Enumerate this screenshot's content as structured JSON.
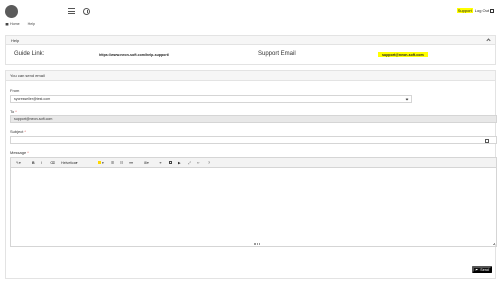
{
  "header": {
    "support_label": "Support",
    "logout_label": "Log Out"
  },
  "breadcrumb": {
    "home": "Home",
    "current": "Help"
  },
  "help_panel": {
    "title": "Help",
    "guide_label": "Guide Link:",
    "guide_url": "https://www.neon-soft.com/help-support/",
    "support_email_label": "Support Email",
    "support_email": "support@neon-soft.com"
  },
  "send_panel": {
    "title": "You can send email",
    "from_label": "From",
    "from_value": "sycresseller@test.com",
    "to_label": "To",
    "to_value": "support@neon-soft.com",
    "subject_label": "Subject",
    "subject_value": "",
    "message_label": "Message",
    "required_mark": "*"
  },
  "editor_toolbar": {
    "font_name": "Helvetica"
  },
  "actions": {
    "send_label": "Send"
  },
  "colors": {
    "highlight": "#ffff00",
    "send_button": "#111111",
    "panel_header": "#f6f6f6"
  }
}
